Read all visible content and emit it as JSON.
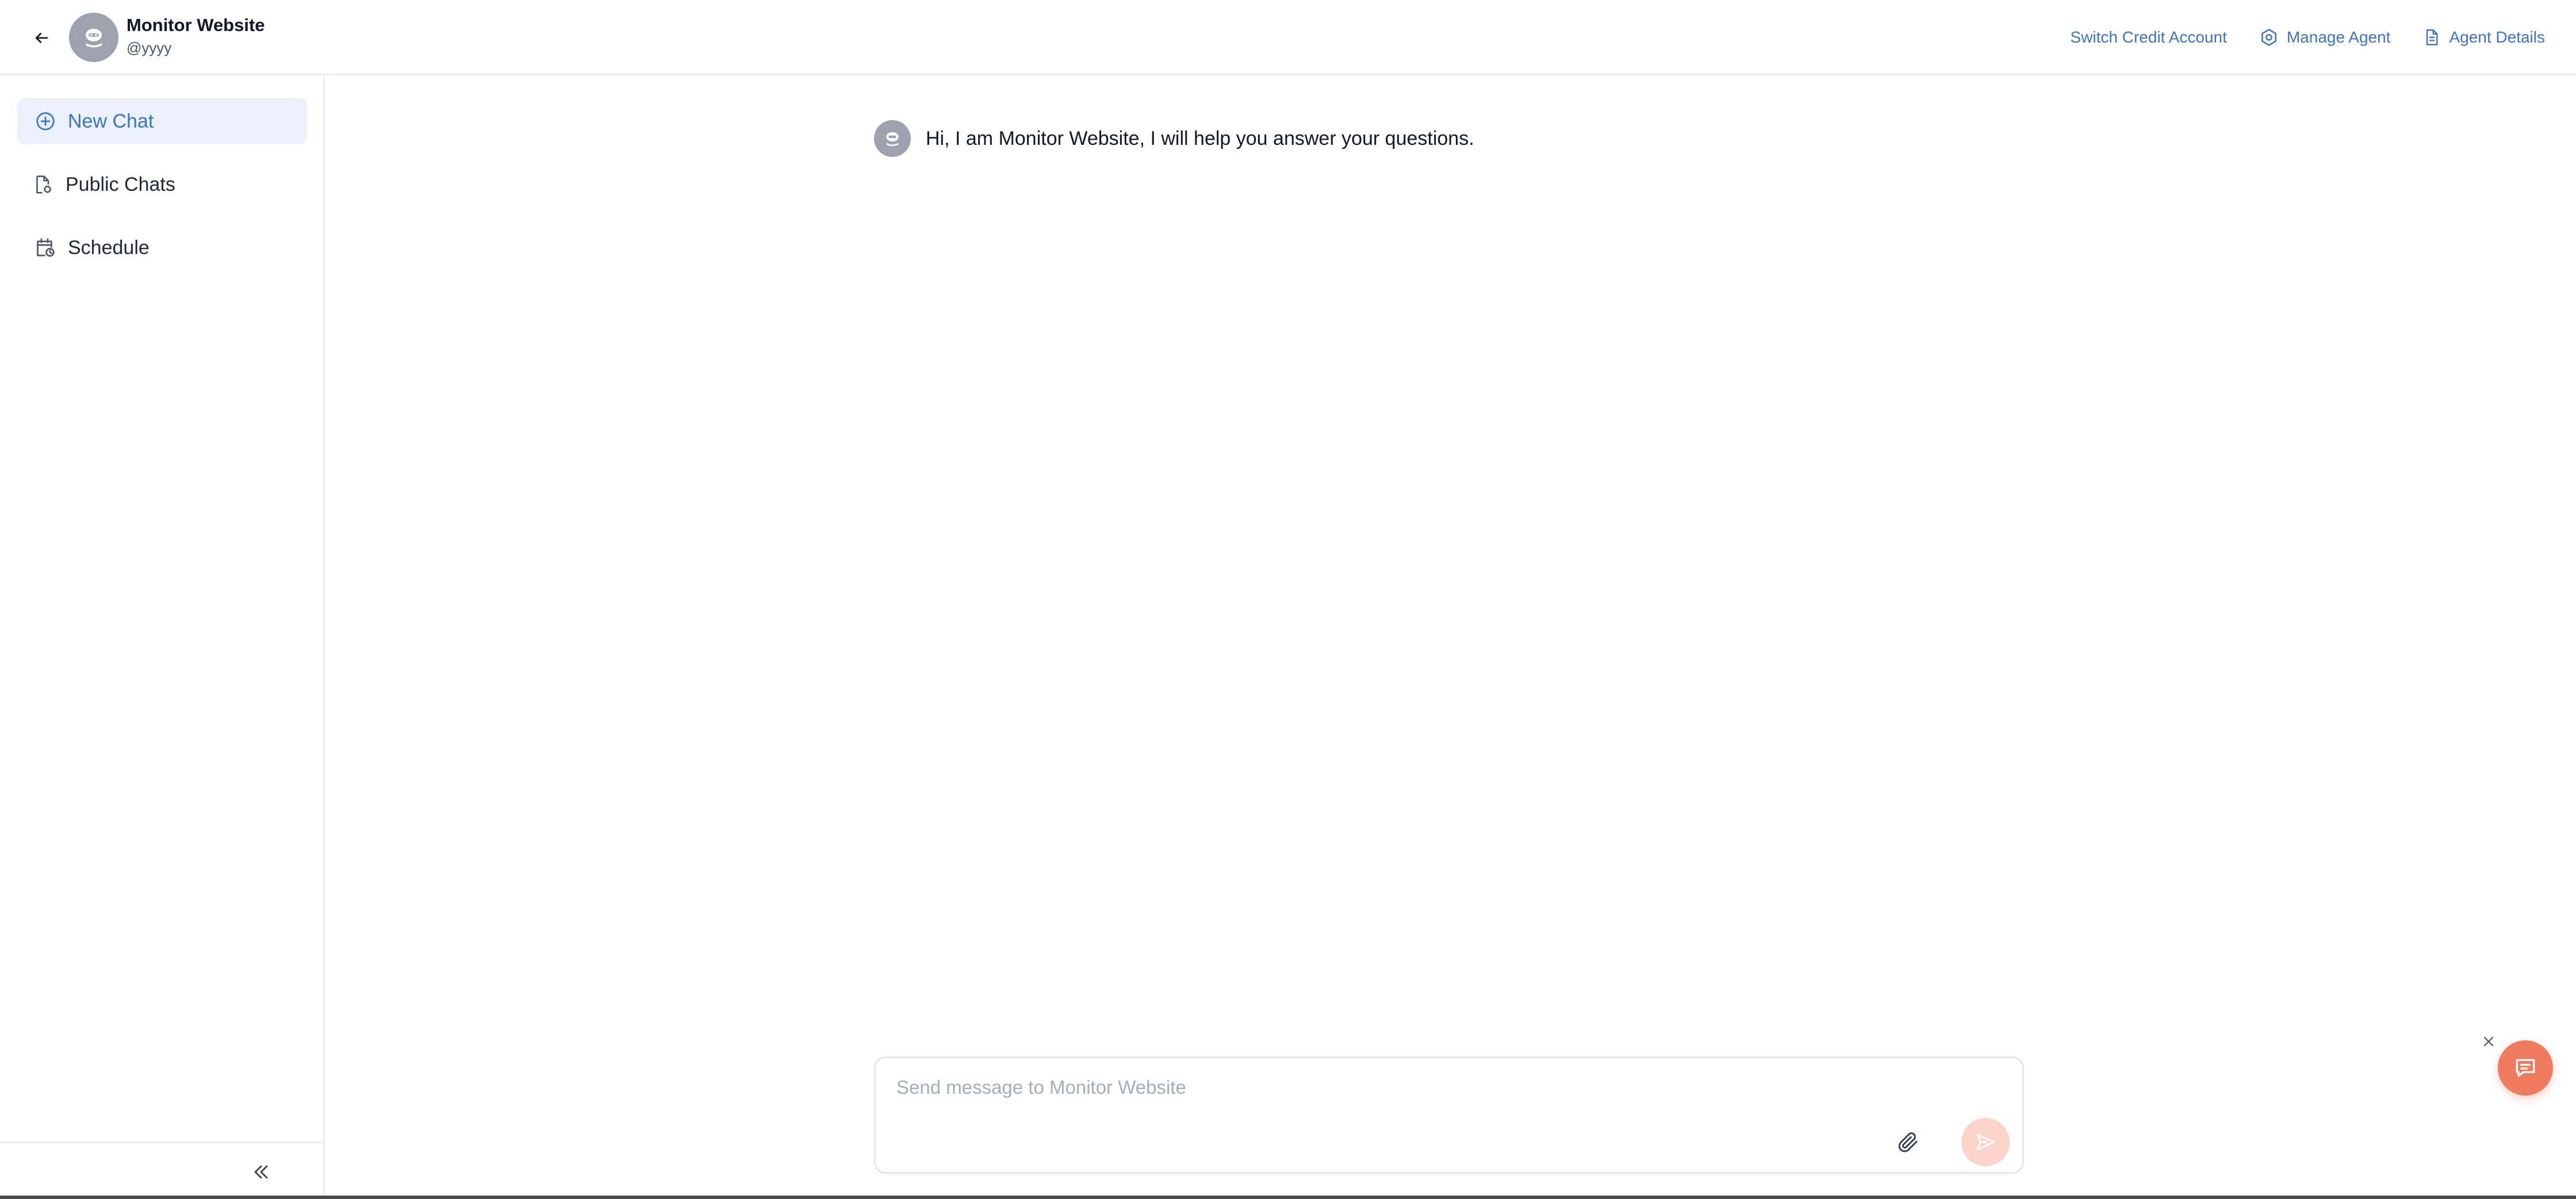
{
  "header": {
    "agent_name": "Monitor Website",
    "agent_handle": "@yyyy",
    "actions": {
      "switch_credit": "Switch Credit Account",
      "manage_agent": "Manage Agent",
      "agent_details": "Agent Details"
    },
    "icons": {
      "back": "arrow-left-icon",
      "avatar": "robot-avatar-icon",
      "manage_agent": "gear-icon",
      "agent_details": "document-icon"
    }
  },
  "sidebar": {
    "items": [
      {
        "label": "New Chat",
        "icon": "plus-circle-icon",
        "active": true
      },
      {
        "label": "Public Chats",
        "icon": "document-share-icon",
        "active": false
      },
      {
        "label": "Schedule",
        "icon": "calendar-clock-icon",
        "active": false
      }
    ],
    "collapse_icon": "double-chevron-left-icon"
  },
  "chat": {
    "messages": [
      {
        "sender": "bot",
        "text": "Hi, I am Monitor Website, I will help you answer your questions."
      }
    ]
  },
  "composer": {
    "placeholder": "Send message to Monitor Website",
    "value": "",
    "attach_icon": "paperclip-icon",
    "send_icon": "send-icon"
  },
  "widget": {
    "close_icon": "close-icon",
    "chat_icon": "chat-bubble-icon"
  },
  "colors": {
    "accent": "#3b74c4",
    "active_bg": "#eaf1fb",
    "widget": "#ef7a5e",
    "send_disabled": "#fbd3c8",
    "avatar": "#9ca3af"
  }
}
